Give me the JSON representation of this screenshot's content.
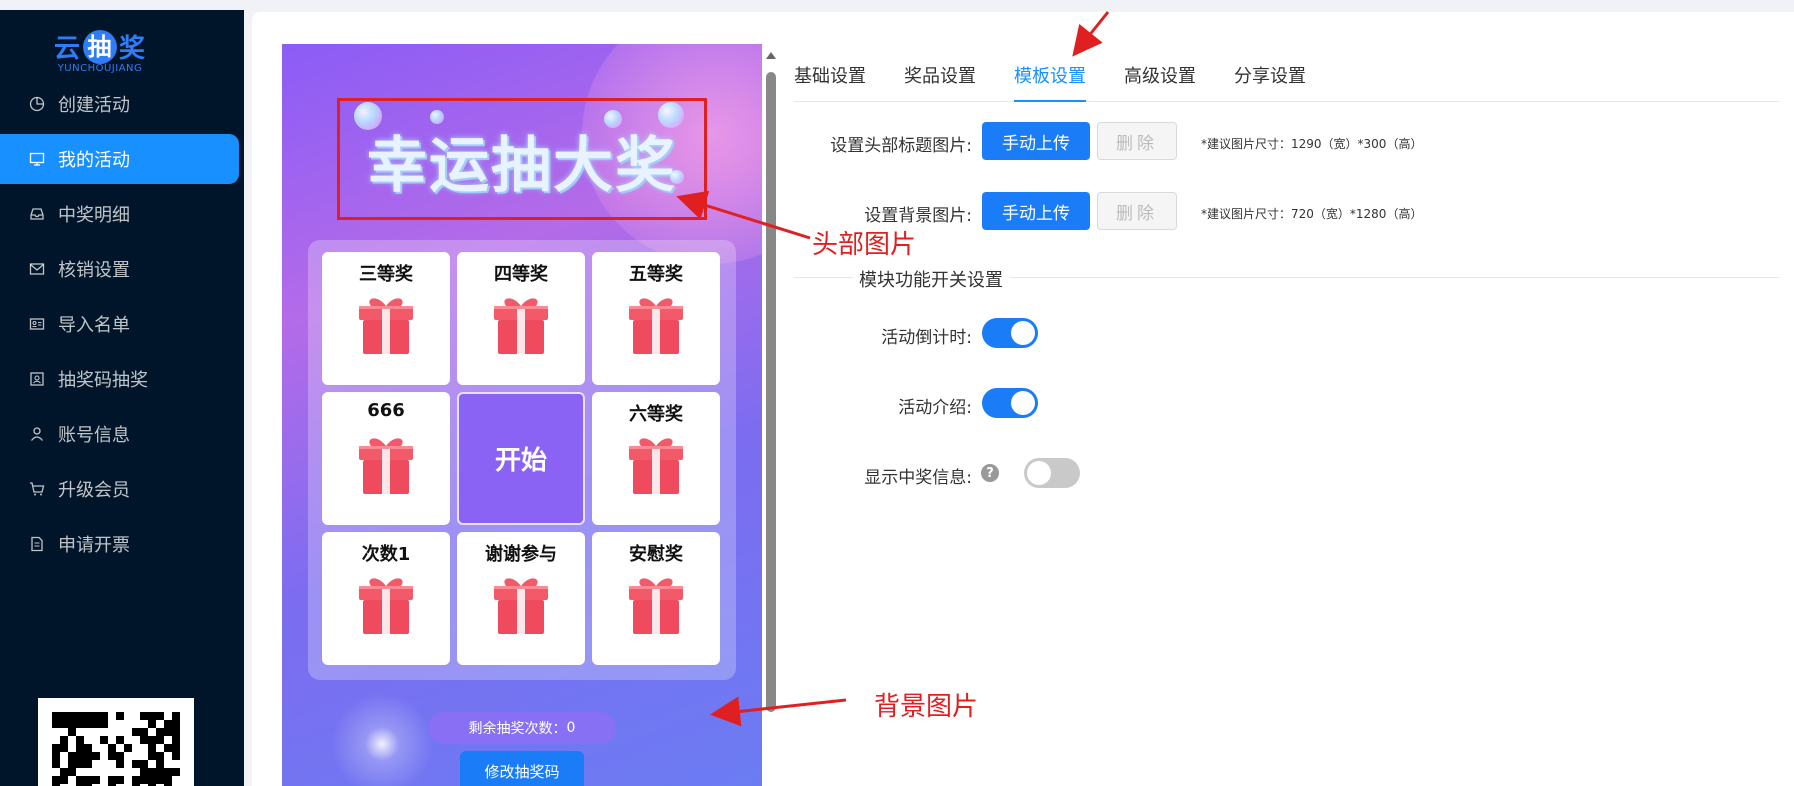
{
  "logo": {
    "left": "云",
    "mid": "抽",
    "right": "奖",
    "sub": "YUNCHOUJIANG"
  },
  "menu": [
    {
      "label": "创建活动",
      "icon": "pie-chart-icon"
    },
    {
      "label": "我的活动",
      "icon": "desktop-icon",
      "active": true
    },
    {
      "label": "中奖明细",
      "icon": "inbox-icon"
    },
    {
      "label": "核销设置",
      "icon": "mail-icon"
    },
    {
      "label": "导入名单",
      "icon": "id-card-icon"
    },
    {
      "label": "抽奖码抽奖",
      "icon": "contacts-icon"
    },
    {
      "label": "账号信息",
      "icon": "user-icon"
    },
    {
      "label": "升级会员",
      "icon": "cart-icon"
    },
    {
      "label": "申请开票",
      "icon": "invoice-icon"
    }
  ],
  "preview": {
    "header_title": "幸运抽大奖",
    "prizes": [
      "三等奖",
      "四等奖",
      "五等奖",
      "666",
      "开始",
      "六等奖",
      "次数1",
      "谢谢参与",
      "安慰奖"
    ],
    "remaining_label": "剩余抽奖次数：",
    "remaining_count": "0",
    "edit_code_button": "修改抽奖码"
  },
  "tabs": [
    {
      "label": "基础设置"
    },
    {
      "label": "奖品设置"
    },
    {
      "label": "模板设置",
      "active": true
    },
    {
      "label": "高级设置"
    },
    {
      "label": "分享设置"
    }
  ],
  "form": {
    "header_image_label": "设置头部标题图片:",
    "background_image_label": "设置背景图片:",
    "upload_button": "手动上传",
    "delete_button": "删除",
    "header_hint": "*建议图片尺寸：1290（宽）*300（高）",
    "background_hint": "*建议图片尺寸：720（宽）*1280（高）",
    "section_title": "模块功能开关设置",
    "countdown_label": "活动倒计时:",
    "countdown_on": true,
    "intro_label": "活动介绍:",
    "intro_on": true,
    "winner_info_label": "显示中奖信息:",
    "winner_info_on": false,
    "help_symbol": "?"
  },
  "annotations": {
    "header_image": "头部图片",
    "background_image": "背景图片",
    "color": "#e02020"
  },
  "colors": {
    "primary": "#1a7cf6",
    "sidebar": "#001529"
  }
}
